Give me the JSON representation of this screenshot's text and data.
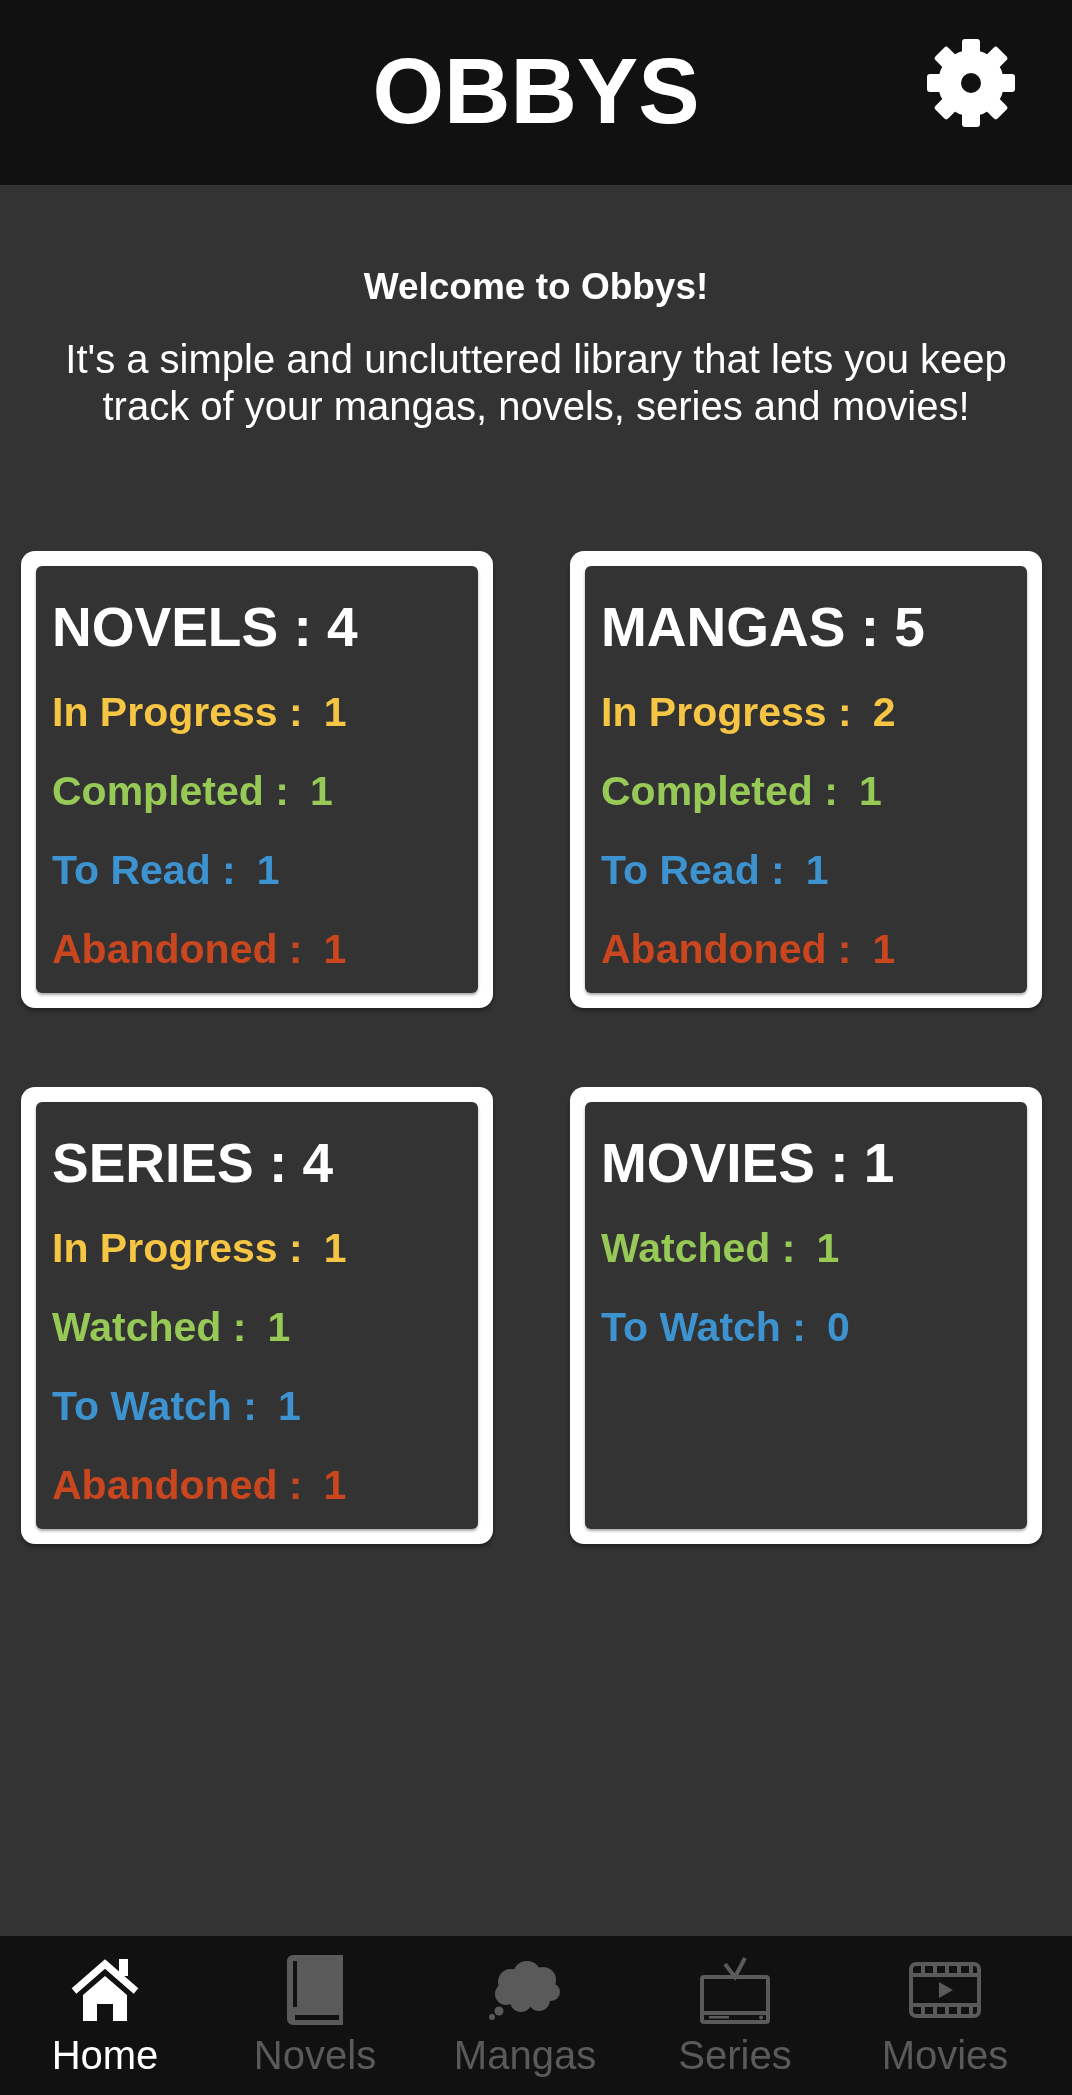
{
  "header": {
    "title": "OBBYS"
  },
  "welcome": {
    "heading": "Welcome to Obbys!",
    "text": "It's a simple and uncluttered library that lets you keep track of your mangas, novels, series and movies!"
  },
  "cards": [
    {
      "title": "NOVELS : 4",
      "stats": [
        {
          "label": "In Progress :",
          "value": "1",
          "color": "#f5c543"
        },
        {
          "label": "Completed :",
          "value": "1",
          "color": "#96c955"
        },
        {
          "label": "To Read :",
          "value": "1",
          "color": "#3d93d0"
        },
        {
          "label": "Abandoned :",
          "value": "1",
          "color": "#c9461f"
        }
      ]
    },
    {
      "title": "MANGAS : 5",
      "stats": [
        {
          "label": "In Progress :",
          "value": "2",
          "color": "#f5c543"
        },
        {
          "label": "Completed :",
          "value": "1",
          "color": "#96c955"
        },
        {
          "label": "To Read :",
          "value": "1",
          "color": "#3d93d0"
        },
        {
          "label": "Abandoned :",
          "value": "1",
          "color": "#c9461f"
        }
      ]
    },
    {
      "title": "SERIES : 4",
      "stats": [
        {
          "label": "In Progress :",
          "value": "1",
          "color": "#f5c543"
        },
        {
          "label": "Watched :",
          "value": "1",
          "color": "#96c955"
        },
        {
          "label": "To Watch :",
          "value": "1",
          "color": "#3d93d0"
        },
        {
          "label": "Abandoned :",
          "value": "1",
          "color": "#c9461f"
        }
      ]
    },
    {
      "title": "MOVIES : 1",
      "stats": [
        {
          "label": "Watched :",
          "value": "1",
          "color": "#96c955"
        },
        {
          "label": "To Watch :",
          "value": "0",
          "color": "#3d93d0"
        }
      ]
    }
  ],
  "bottom_nav": [
    {
      "label": "Home",
      "selected": true
    },
    {
      "label": "Novels",
      "selected": false
    },
    {
      "label": "Mangas",
      "selected": false
    },
    {
      "label": "Series",
      "selected": false
    },
    {
      "label": "Movies",
      "selected": false
    }
  ]
}
